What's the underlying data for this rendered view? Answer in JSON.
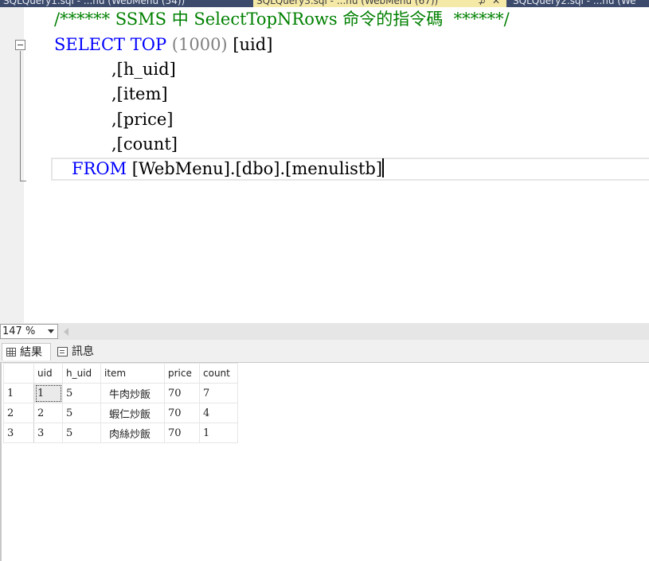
{
  "tabs": [
    {
      "label": "SQLQuery1.sql - ...nu (WebMenu (54))",
      "active": false
    },
    {
      "label": "SQLQuery3.sql - ...nu (WebMenu (67))",
      "active": true
    },
    {
      "label": "SQLQuery2.sql - ...nu (We",
      "active": false
    }
  ],
  "editor": {
    "comment": "/****** SSMS 中 SelectTopNRows 命令的指令碼  ******/",
    "kw_select": "SELECT",
    "kw_top": "TOP",
    "top_count": " (1000) ",
    "first_col": "[uid]",
    "columns": [
      ",[h_uid]",
      ",[item]",
      ",[price]",
      ",[count]"
    ],
    "kw_from": "FROM",
    "from_table": " [WebMenu].[dbo].[menulistb]"
  },
  "zoom": {
    "value": "147 %"
  },
  "result_tabs": {
    "results": "結果",
    "messages": "訊息"
  },
  "grid": {
    "headers": [
      "uid",
      "h_uid",
      "item",
      "price",
      "count"
    ],
    "rows": [
      {
        "n": "1",
        "uid": "1",
        "h_uid": "5",
        "item": "牛肉炒飯",
        "price": "70",
        "count": "7"
      },
      {
        "n": "2",
        "uid": "2",
        "h_uid": "5",
        "item": "蝦仁炒飯",
        "price": "70",
        "count": "4"
      },
      {
        "n": "3",
        "uid": "3",
        "h_uid": "5",
        "item": "肉絲炒飯",
        "price": "70",
        "count": "1"
      }
    ]
  },
  "colors": {
    "keyword": "#0000ff",
    "comment": "#008000",
    "paren": "#808080",
    "active_tab": "#f5e9a8"
  }
}
